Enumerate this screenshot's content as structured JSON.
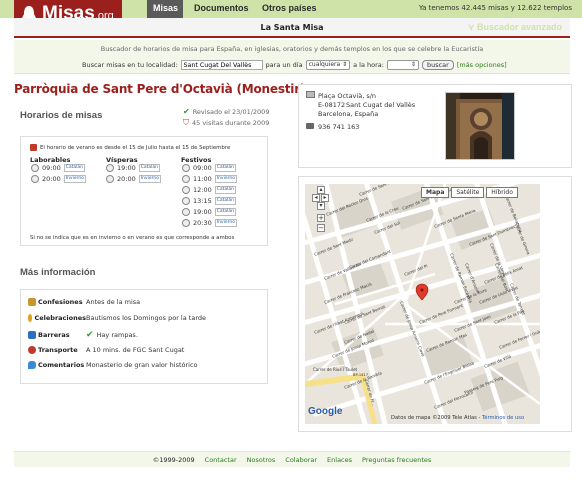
{
  "header": {
    "logo_text": "Misas",
    "logo_suffix": ".org",
    "nav": [
      "Misas",
      "Documentos",
      "Otros países"
    ],
    "counter": "Ya tenemos 42.445 misas y 12.622 templos"
  },
  "titlebar": {
    "title": "La Santa Misa",
    "advanced": "Buscador avanzado"
  },
  "search": {
    "description": "Buscador de horarios de misa para España, en iglesias, oratorios y demás templos en los que se celebre la Eucaristía",
    "label_location": "Buscar misas en tu localidad:",
    "location_value": "Sant Cugat Del Vallès",
    "label_day": "para un día",
    "day_value": "cualquiera",
    "label_time": "a la hora:",
    "time_value": "",
    "search_button": "buscar",
    "more_options": "[más opciones]"
  },
  "church": {
    "name": "Parròquia de Sant Pere d'Octavià (Monestir)"
  },
  "schedule": {
    "title": "Horarios de misas",
    "revised": "Revisado el 23/01/2009",
    "visits": "45 visitas durante 2009",
    "summer_note": "El horario de verano es desde el 15 de Julio hasta el 15 de Septiembre",
    "columns": [
      {
        "title": "Laborables",
        "rows": [
          {
            "time": "09:00",
            "tag": "Catalán"
          },
          {
            "time": "20:00",
            "tag": "Invierno"
          }
        ]
      },
      {
        "title": "Vísperas",
        "rows": [
          {
            "time": "19:00",
            "tag": "Catalán"
          },
          {
            "time": "20:00",
            "tag": "Invierno"
          }
        ]
      },
      {
        "title": "Festivos",
        "rows": [
          {
            "time": "09:00",
            "tag": "Catalán"
          },
          {
            "time": "11:00",
            "tag": "Invierno"
          },
          {
            "time": "12:00",
            "tag": "Catalán"
          },
          {
            "time": "13:15",
            "tag": "Catalán"
          },
          {
            "time": "19:00",
            "tag": "Catalán"
          },
          {
            "time": "20:30",
            "tag": "Invierno"
          }
        ]
      }
    ],
    "footnote": "Si no se indica que es en invierno o en verano es que corresponde a ambos"
  },
  "more": {
    "title": "Más información",
    "rows": [
      {
        "label": "Confesiones",
        "value": "Antes de la misa",
        "color": "#c8962c"
      },
      {
        "label": "Celebraciones",
        "value": "Bautismos los Domingos por la tarde",
        "color": "#e0a020"
      },
      {
        "label": "Barreras",
        "value": "Hay rampas.",
        "color": "#2a6fc2"
      },
      {
        "label": "Transporte",
        "value": "A 10 mins. de FGC Sant Cugat",
        "color": "#c0392b"
      },
      {
        "label": "Comentarios",
        "value": "Monasterio de gran valor histórico",
        "color": "#3a8ad6"
      }
    ]
  },
  "address": {
    "street": "Plaça Octavià, s/n",
    "postal": "E-08172",
    "city": "Sant Cugat del Vallès",
    "region": "Barcelona, España",
    "phone": "936 741 163"
  },
  "map": {
    "types": [
      "Mapa",
      "Satélite",
      "Híbrido"
    ],
    "copyright": "Datos de mapa ©2009 Tele Atlas",
    "terms": "Términos de uso",
    "streets": [
      "Carrer de Sant Antoni",
      "Carrer de Sant Bonaventura",
      "Carrer del Rector Oms",
      "Carrer de la Creu",
      "Carrer de Sant Medir",
      "Carrer del Sol",
      "Carrer de Sant Domènec",
      "Carrer de Santa Maria",
      "Carrer de Valldoreix",
      "Carrer de Lluís Vives",
      "Carrer del Pi",
      "Carrer de Francesc Macià",
      "Carrer de Ramon Escayola",
      "Carrer de Sant Joan",
      "Carrer de la Vinya",
      "Carrer de Villà",
      "Carrer de Josep Anselm Clavé",
      "Carrer de Ramon Mas",
      "Carrer de Pere Forment",
      "Carrer de la Torre",
      "Carrer de Sant Bernat",
      "Carrer de Nadal",
      "Carrer de Josep Moruó",
      "Passeig de Pere Puig",
      "Carrer de Bellaterra",
      "Carrer de Fèlix Amat",
      "Carrer de l'Abat Armengol",
      "Carrer de la Pau",
      "Carrer de l'Enginyer Bielsa",
      "Carrer de Ferrer i Guàrdia",
      "Carrer del Comandant",
      "Carrer del Ferrocarril",
      "Carrer de la Rambla",
      "Carrer de Rius i Taulet",
      "Carrer del Bosc",
      "Carrer de Torrent",
      "Carrer de Girona",
      "Carrer d'Anselm",
      "BP-1417",
      "Carrer de Fr..."
    ],
    "logo": "Google"
  },
  "footer": {
    "copyright": "©1999-2009",
    "links": [
      "Contactar",
      "Nosotros",
      "Colaborar",
      "Enlaces",
      "Preguntas frecuentes"
    ]
  }
}
